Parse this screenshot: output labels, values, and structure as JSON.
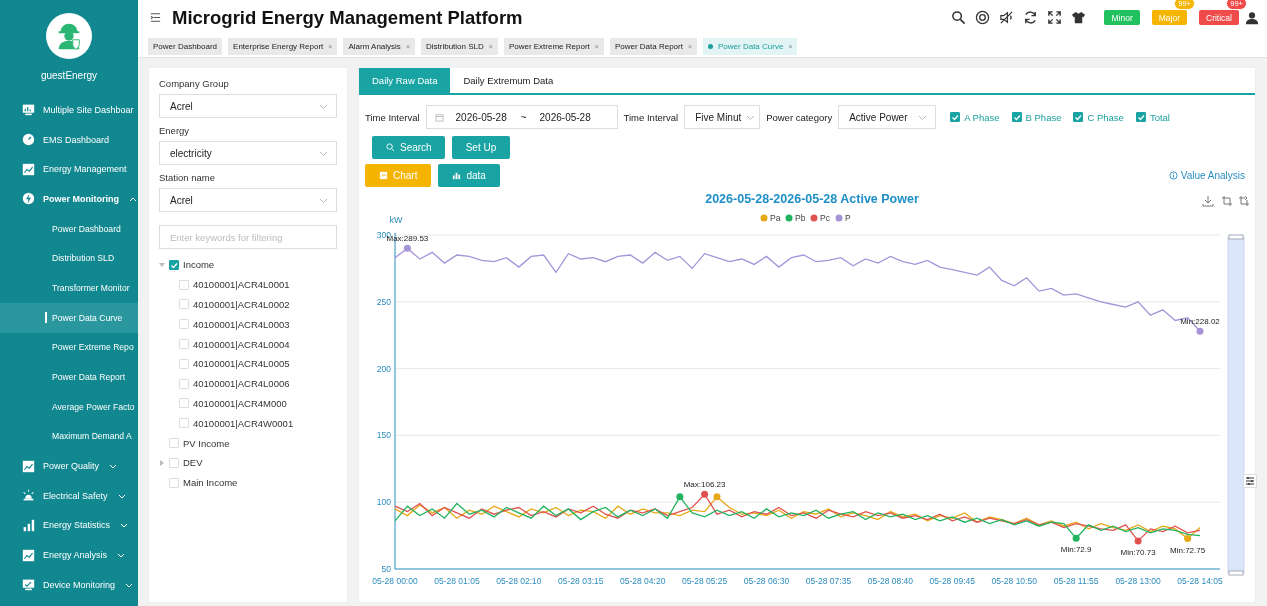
{
  "sidebar": {
    "user": "guestEnergy",
    "items": [
      {
        "label": "Multiple Site Dashboar"
      },
      {
        "label": "EMS Dashboard"
      },
      {
        "label": "Energy Management"
      },
      {
        "label": "Power Monitoring",
        "expanded": true,
        "children": [
          {
            "label": "Power Dashboard",
            "selected": false
          },
          {
            "label": "Distribution SLD",
            "selected": false
          },
          {
            "label": "Transformer Monitor",
            "selected": false
          },
          {
            "label": "Power Data Curve",
            "selected": true
          },
          {
            "label": "Power Extreme Repo",
            "selected": false
          },
          {
            "label": "Power Data Report",
            "selected": false
          },
          {
            "label": "Average Power Facto",
            "selected": false
          },
          {
            "label": "Maximum Demand A",
            "selected": false
          }
        ]
      },
      {
        "label": "Power Quality",
        "expanded": false
      },
      {
        "label": "Electrical Safety",
        "expanded": false
      },
      {
        "label": "Energy Statistics",
        "expanded": false
      },
      {
        "label": "Energy Analysis",
        "expanded": false
      },
      {
        "label": "Device Monitoring",
        "expanded": false
      }
    ]
  },
  "header": {
    "title": "Microgrid Energy Management Platform",
    "alarms": [
      {
        "label": "Minor",
        "color": "#22c160"
      },
      {
        "label": "Major",
        "count": "99+",
        "color": "#f5b400"
      },
      {
        "label": "Critical",
        "count": "99+",
        "color": "#ef4b4b"
      }
    ]
  },
  "tabs": [
    {
      "label": "Power Dashboard",
      "selected": false
    },
    {
      "label": "Enterprise Energy Report",
      "close": "×",
      "selected": false
    },
    {
      "label": "Alarm Analysis",
      "close": "×",
      "selected": false
    },
    {
      "label": "Distribution SLD",
      "close": "×",
      "selected": false
    },
    {
      "label": "Power Extreme Report",
      "close": "×",
      "selected": false
    },
    {
      "label": "Power Data Report",
      "close": "×",
      "selected": false
    },
    {
      "label": "Power Data Curve",
      "close": "×",
      "selected": true
    }
  ],
  "filters": {
    "fields": [
      {
        "label": "Company Group",
        "value": "Acrel"
      },
      {
        "label": "Energy",
        "value": "electricity"
      },
      {
        "label": "Station name",
        "value": "Acrel"
      }
    ],
    "search": {
      "placeholder": "Enter keywords for filtering"
    },
    "tree": [
      {
        "label": "Income",
        "checked": true,
        "expanded": true,
        "children": [
          {
            "label": "40100001|ACR4L0001",
            "checked": false
          },
          {
            "label": "40100001|ACR4L0002",
            "checked": false
          },
          {
            "label": "40100001|ACR4L0003",
            "checked": false
          },
          {
            "label": "40100001|ACR4L0004",
            "checked": false
          },
          {
            "label": "40100001|ACR4L0005",
            "checked": false
          },
          {
            "label": "40100001|ACR4L0006",
            "checked": false
          },
          {
            "label": "40100001|ACR4M000",
            "checked": false
          },
          {
            "label": "40100001|ACR4W0001",
            "checked": false
          }
        ]
      },
      {
        "label": "PV Income",
        "checked": false
      },
      {
        "label": "DEV",
        "checked": false,
        "expanded": false
      },
      {
        "label": "Main Income",
        "checked": false
      }
    ]
  },
  "report": {
    "tabs": [
      {
        "label": "Daily Raw Data",
        "selected": true
      },
      {
        "label": "Daily Extremum Data",
        "selected": false
      }
    ],
    "time_label": "Time Interval",
    "date_range": {
      "start": "2026-05-28",
      "separator": "~",
      "end": "2026-05-28"
    },
    "interval_label": "Time Interval",
    "interval": "Five Minut",
    "category_label": "Power category",
    "category": "Active Power",
    "phases": [
      {
        "label": "A Phase",
        "checked": true
      },
      {
        "label": "B Phase",
        "checked": true
      },
      {
        "label": "C Phase",
        "checked": true
      },
      {
        "label": "Total",
        "checked": true
      }
    ],
    "buttons": [
      "Search",
      "Set Up"
    ],
    "views": [
      {
        "label": "Chart",
        "selected": true
      },
      {
        "label": "data",
        "selected": false
      }
    ],
    "value_analysis": "Value Analysis",
    "chart_data": {
      "type": "line",
      "title": "2026-05-28-2026-05-28  Active Power",
      "ylabel": "kW",
      "categories": [
        "05-28 00:00",
        null,
        null,
        null,
        null,
        "05-28 01:05",
        null,
        null,
        null,
        null,
        "05-28 02:10",
        null,
        null,
        null,
        null,
        "05-28 03:15",
        null,
        null,
        null,
        null,
        "05-28 04:20",
        null,
        null,
        null,
        null,
        "05-28 05:25",
        null,
        null,
        null,
        null,
        "05-28 06:30",
        null,
        null,
        null,
        null,
        "05-28 07:35",
        null,
        null,
        null,
        null,
        "05-28 08:40",
        null,
        null,
        null,
        null,
        "05-28 09:45",
        null,
        null,
        null,
        null,
        "05-28 10:50",
        null,
        null,
        null,
        null,
        "05-28 11:55",
        null,
        null,
        null,
        null,
        "05-28 13:00",
        null,
        null,
        null,
        null,
        "05-28 14:05"
      ],
      "ylim": [
        50,
        300
      ],
      "yticks": [
        50,
        100,
        150,
        200,
        250,
        300
      ],
      "grid": true,
      "legend": true,
      "series": [
        {
          "name": "Pa",
          "color": "#e6a817",
          "values": [
            95,
            90,
            98,
            92,
            96,
            88,
            94,
            91,
            97,
            93,
            89,
            95,
            92,
            96,
            90,
            94,
            93,
            88,
            97,
            91,
            95,
            92,
            92,
            90,
            94,
            93,
            104,
            96,
            91,
            92,
            90,
            94,
            88,
            93,
            91,
            95,
            89,
            92,
            90,
            87,
            93,
            89,
            91,
            86,
            90,
            88,
            92,
            85,
            89,
            87,
            84,
            88,
            83,
            86,
            82,
            85,
            80,
            84,
            81,
            79,
            83,
            78,
            82,
            80,
            72.8,
            81
          ]
        },
        {
          "name": "Pb",
          "color": "#22b35e",
          "values": [
            86,
            97,
            90,
            95,
            88,
            99,
            91,
            94,
            89,
            96,
            92,
            88,
            97,
            90,
            95,
            87,
            93,
            96,
            89,
            94,
            90,
            95,
            88,
            104,
            92,
            89,
            94,
            90,
            93,
            88,
            95,
            89,
            92,
            90,
            94,
            88,
            91,
            93,
            87,
            92,
            89,
            91,
            87,
            90,
            86,
            89,
            85,
            88,
            84,
            87,
            83,
            86,
            82,
            85,
            84,
            73,
            83,
            79,
            82,
            78,
            81,
            77,
            80,
            79,
            76,
            75
          ]
        },
        {
          "name": "Pc",
          "color": "#e05252",
          "values": [
            97,
            93,
            99,
            90,
            96,
            92,
            88,
            95,
            91,
            94,
            96,
            90,
            93,
            89,
            95,
            92,
            97,
            91,
            88,
            94,
            92,
            95,
            90,
            93,
            96,
            106,
            91,
            94,
            89,
            93,
            91,
            96,
            90,
            92,
            88,
            94,
            91,
            89,
            93,
            90,
            92,
            88,
            90,
            87,
            91,
            86,
            89,
            85,
            88,
            86,
            84,
            87,
            83,
            85,
            81,
            84,
            82,
            80,
            79,
            83,
            71,
            80,
            78,
            82,
            77,
            79
          ]
        },
        {
          "name": "P",
          "color": "#a594d8",
          "values": [
            283,
            290,
            282,
            287,
            279,
            285,
            284,
            281,
            280,
            283,
            276,
            284,
            285,
            272,
            286,
            282,
            283,
            280,
            284,
            285,
            279,
            287,
            281,
            284,
            275,
            286,
            283,
            280,
            282,
            278,
            284,
            276,
            283,
            285,
            280,
            281,
            283,
            277,
            282,
            279,
            284,
            280,
            278,
            281,
            276,
            274,
            272,
            270,
            276,
            266,
            262,
            268,
            258,
            260,
            255,
            256,
            253,
            250,
            248,
            246,
            250,
            240,
            244,
            236,
            238,
            228
          ]
        }
      ],
      "annotations": [
        {
          "y": 290,
          "text": "Max:289.53"
        },
        {
          "y": 228,
          "text": "Min:228.02"
        },
        {
          "y": 106,
          "text": "Max:106.23"
        },
        {
          "y": 73,
          "text": "Min:72.9"
        },
        {
          "y": 71,
          "text": "Min:70.73"
        },
        {
          "y": 72.8,
          "text": "Min:72.75"
        }
      ]
    }
  }
}
